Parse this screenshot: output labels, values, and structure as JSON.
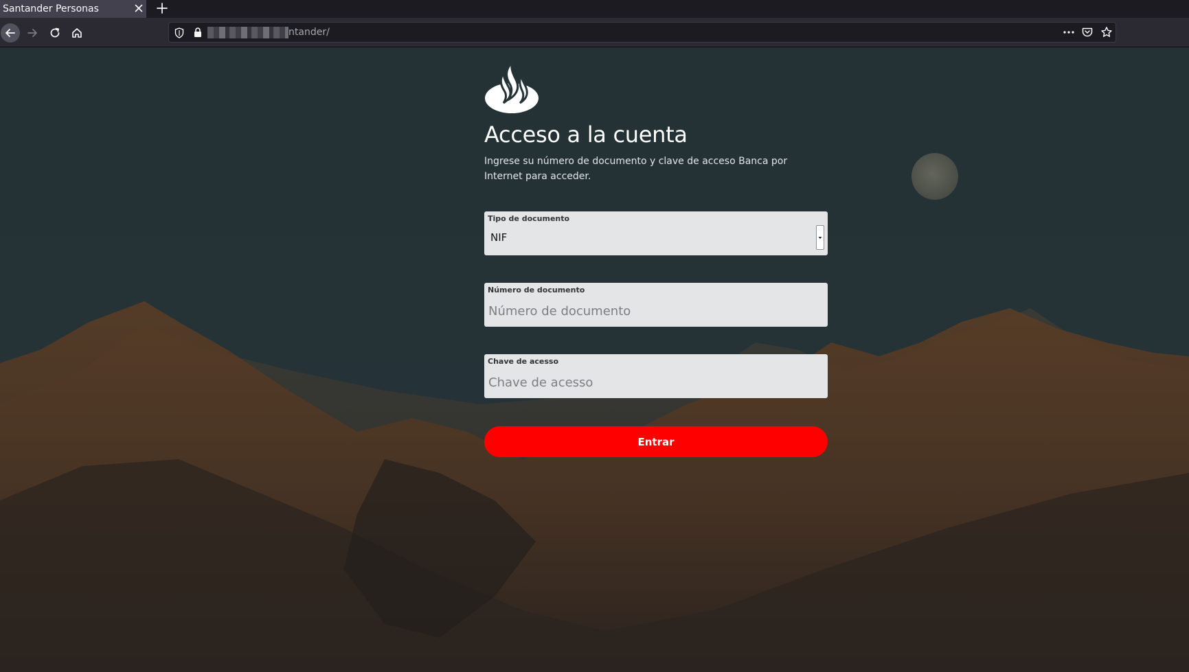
{
  "browser": {
    "tab_title": "Santander Personas",
    "url_visible": "ntander/",
    "icons": [
      "tab-close-icon",
      "new-tab-icon",
      "back-arrow-icon",
      "forward-arrow-icon",
      "reload-icon",
      "home-icon",
      "shield-icon",
      "lock-icon",
      "more-dots-icon",
      "pocket-icon",
      "bookmark-star-icon"
    ]
  },
  "page": {
    "logo": "santander-flame-logo",
    "heading": "Acceso a la cuenta",
    "subtitle": "Ingrese su número de documento y clave de acceso Banca por Internet para acceder.",
    "form": {
      "doc_type": {
        "label": "Tipo de documento",
        "value": "NIF"
      },
      "doc_number": {
        "label": "Número de documento",
        "placeholder": "Número de documento",
        "value": ""
      },
      "access_key": {
        "label": "Chave de acesso",
        "placeholder": "Chave de acesso",
        "value": ""
      },
      "submit_label": "Entrar"
    },
    "colors": {
      "accent": "#ff0000",
      "background": "#243236",
      "field_bg": "#e3e5e7",
      "text": "#ffffff"
    }
  }
}
